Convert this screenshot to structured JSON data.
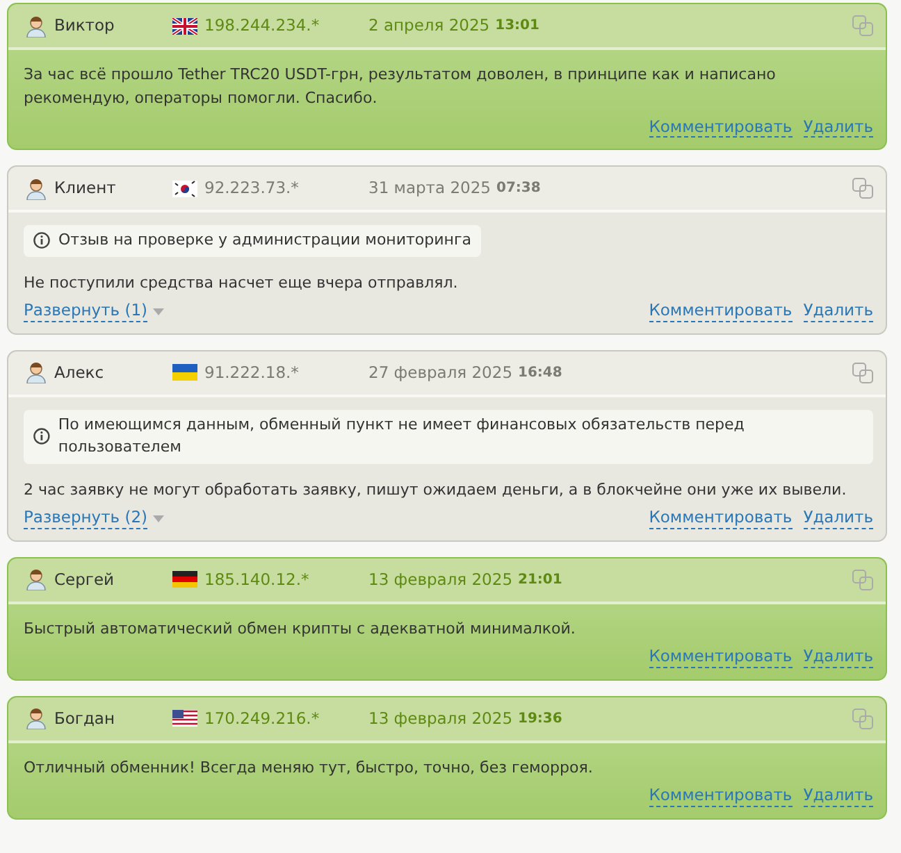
{
  "reviews": [
    {
      "kind": "positive",
      "author": "Виктор",
      "flag": {
        "kind": "gb"
      },
      "ip": "198.244.234.*",
      "date": "2 апреля 2025",
      "time": "13:01",
      "text": "За час всё прошло Tether TRC20 USDT-грн, результатом доволен, в принципе как и написано рекомендую, операторы помогли. Спасибо.",
      "actions": [
        "Комментировать",
        "Удалить"
      ]
    },
    {
      "kind": "neutral",
      "author": "Клиент",
      "flag": {
        "kind": "kr"
      },
      "ip": "92.223.73.*",
      "date": "31 марта 2025",
      "time": "07:38",
      "notice": "Отзыв на проверке у администрации мониторинга",
      "text": "Не поступили средства насчет еще вчера отправлял.",
      "expand": "Развернуть (1)",
      "actions": [
        "Комментировать",
        "Удалить"
      ]
    },
    {
      "kind": "neutral",
      "author": "Алекс",
      "flag": {
        "kind": "ua"
      },
      "ip": "91.222.18.*",
      "date": "27 февраля 2025",
      "time": "16:48",
      "notice": "По имеющимся данным, обменный пункт не имеет финансовых обязательств перед пользователем",
      "text": "2 час заявку не могут обработать заявку, пишут ожидаем деньги, а в блокчейне они уже их вывели.",
      "expand": "Развернуть (2)",
      "actions": [
        "Комментировать",
        "Удалить"
      ]
    },
    {
      "kind": "positive",
      "author": "Сергей",
      "flag": {
        "kind": "de"
      },
      "ip": "185.140.12.*",
      "date": "13 февраля 2025",
      "time": "21:01",
      "text": "Быстрый автоматический обмен крипты с адекватной минималкой.",
      "actions": [
        "Комментировать",
        "Удалить"
      ]
    },
    {
      "kind": "positive",
      "author": "Богдан",
      "flag": {
        "kind": "us"
      },
      "ip": "170.249.216.*",
      "date": "13 февраля 2025",
      "time": "19:36",
      "text": "Отличный обменник! Всегда меняю тут, быстро, точно, без геморроя.",
      "actions": [
        "Комментировать",
        "Удалить"
      ]
    }
  ]
}
